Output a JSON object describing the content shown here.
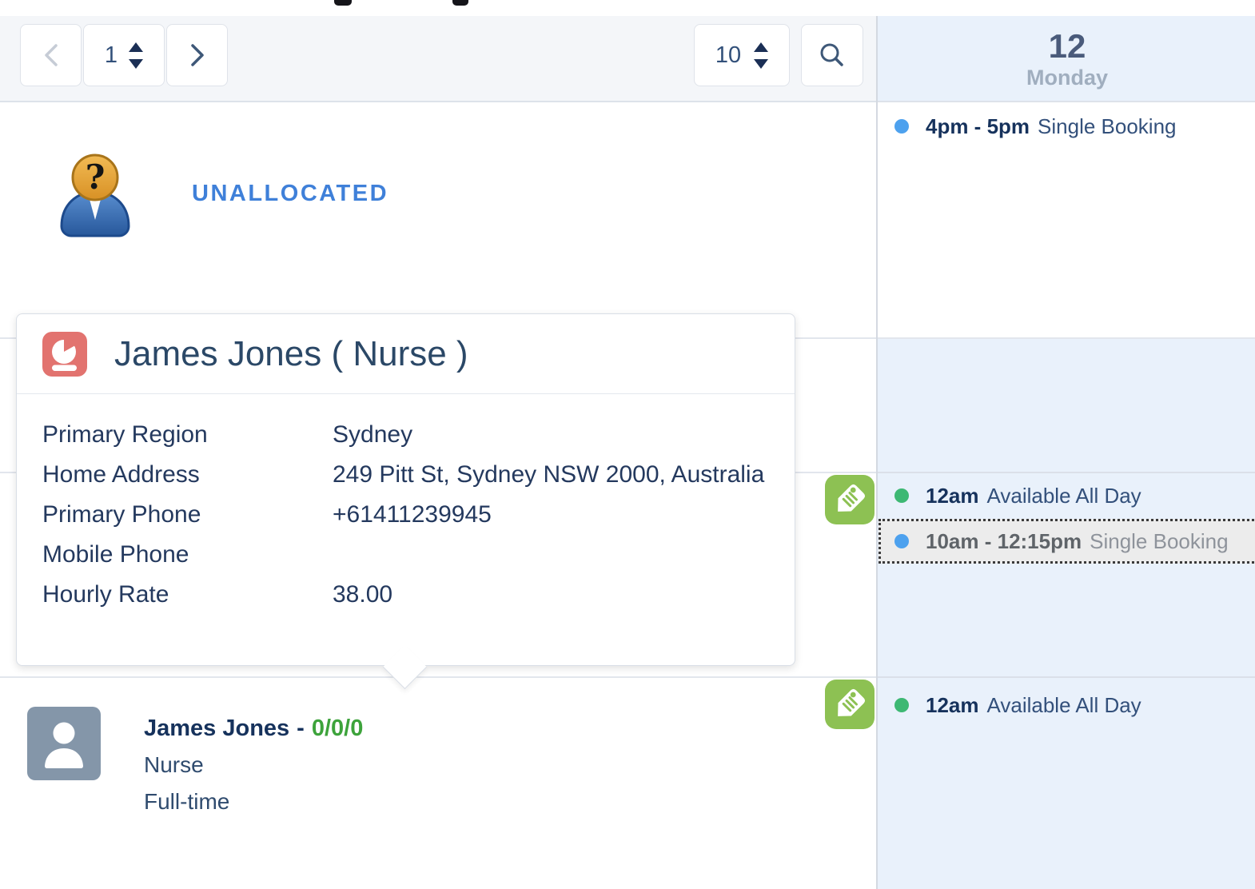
{
  "toolbar": {
    "page_value": "1",
    "page_size_value": "10"
  },
  "resource_list": {
    "unallocated_label": "UNALLOCATED",
    "resource": {
      "name": "James Jones",
      "separator": "-",
      "counts": "0/0/0",
      "role": "Nurse",
      "employment": "Full-time"
    }
  },
  "popover": {
    "title": "James Jones ( Nurse )",
    "fields": [
      {
        "label": "Primary Region",
        "value": "Sydney"
      },
      {
        "label": "Home Address",
        "value": "249 Pitt St, Sydney NSW 2000, Australia"
      },
      {
        "label": "Primary Phone",
        "value": "+61411239945"
      },
      {
        "label": "Mobile Phone",
        "value": ""
      },
      {
        "label": "Hourly Rate",
        "value": "38.00"
      }
    ]
  },
  "calendar": {
    "day_number": "12",
    "day_name": "Monday",
    "events": [
      {
        "time": "4pm - 5pm",
        "title": "Single Booking",
        "dot": "blue"
      },
      {
        "time": "12am",
        "title": "Available All Day",
        "dot": "green"
      },
      {
        "time": "10am - 12:15pm",
        "title": "Single Booking",
        "dot": "blue",
        "state": "selected"
      },
      {
        "time": "12am",
        "title": "Available All Day",
        "dot": "green"
      }
    ]
  },
  "colors": {
    "accent_blue": "#3f80d9",
    "navy_text": "#16325c",
    "calendar_bg": "#e9f1fb",
    "toolbar_bg": "#f4f6f9",
    "green_dot": "#3db873",
    "blue_dot": "#4da1ee",
    "tag_green": "#8dc153",
    "resource_icon_red": "#e2736f",
    "counts_green": "#3da33b"
  }
}
